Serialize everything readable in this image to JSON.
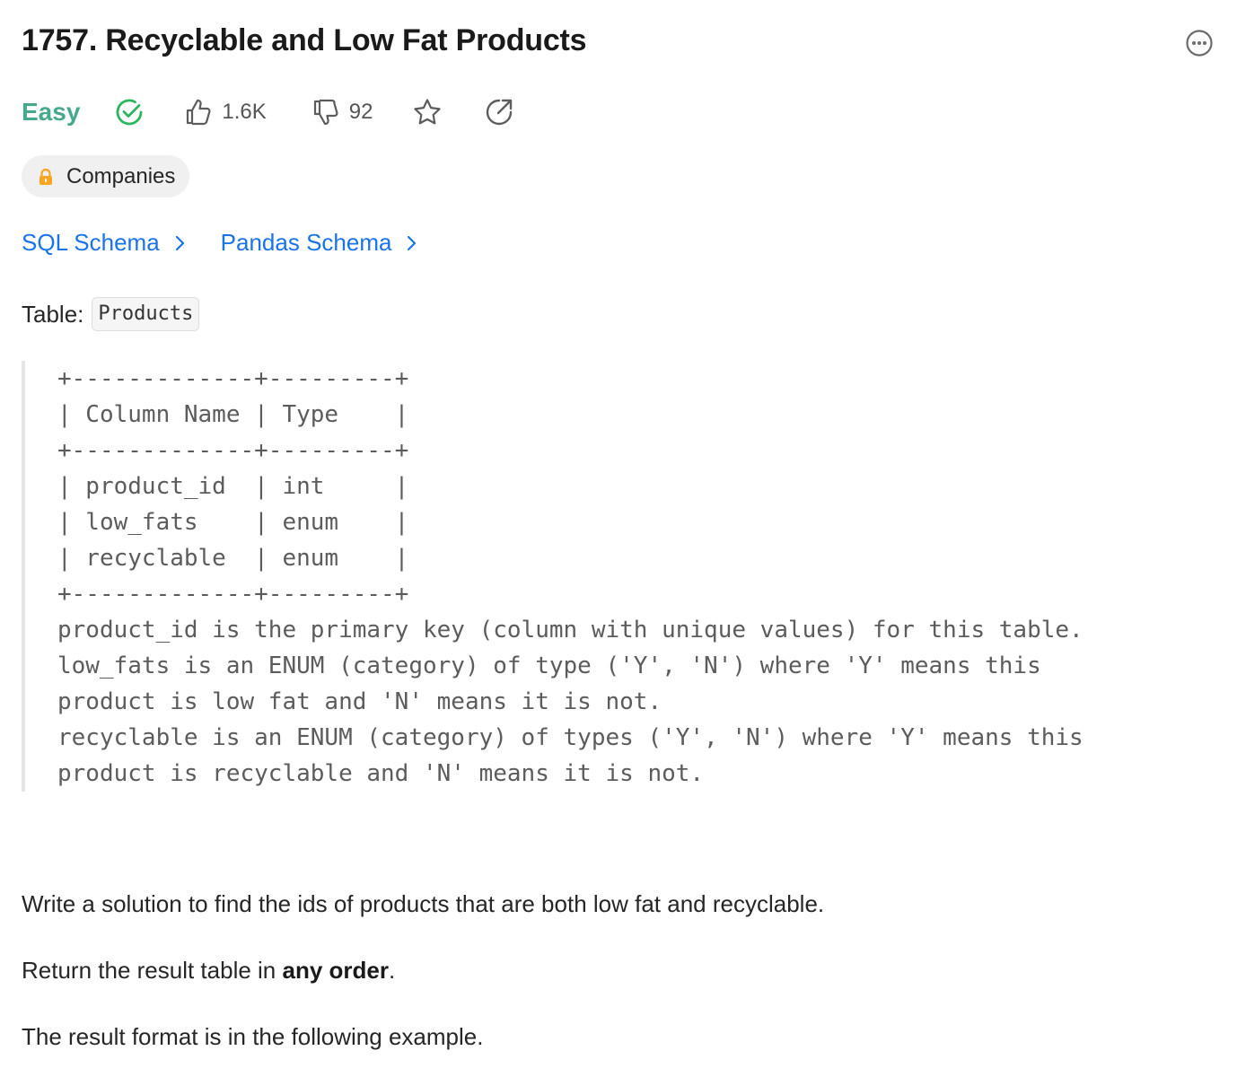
{
  "problem": {
    "title": "1757. Recyclable and Low Fat Products",
    "difficulty": "Easy",
    "likes": "1.6K",
    "dislikes": "92",
    "companies_label": "Companies"
  },
  "schema_links": [
    {
      "label": "SQL Schema"
    },
    {
      "label": "Pandas Schema"
    }
  ],
  "table": {
    "label": "Table:",
    "name": "Products"
  },
  "schema_text": "+-------------+---------+\n| Column Name | Type    |\n+-------------+---------+\n| product_id  | int     |\n| low_fats    | enum    |\n| recyclable  | enum    |\n+-------------+---------+\nproduct_id is the primary key (column with unique values) for this table.\nlow_fats is an ENUM (category) of type ('Y', 'N') where 'Y' means this\nproduct is low fat and 'N' means it is not.\nrecyclable is an ENUM (category) of types ('Y', 'N') where 'Y' means this\nproduct is recyclable and 'N' means it is not.",
  "description": {
    "line1": "Write a solution to find the ids of products that are both low fat and recyclable.",
    "line2_prefix": "Return the result table in ",
    "line2_bold": "any order",
    "line2_suffix": ".",
    "line3": "The result format is in the following example."
  },
  "colors": {
    "easy": "#46a98e",
    "solved": "#2db55d",
    "link": "#1a73e8",
    "lock": "#f6a623"
  },
  "icons": [
    "more-icon",
    "check-circle-icon",
    "thumbs-up-icon",
    "thumbs-down-icon",
    "star-icon",
    "share-icon",
    "lock-icon",
    "chevron-right-icon"
  ]
}
